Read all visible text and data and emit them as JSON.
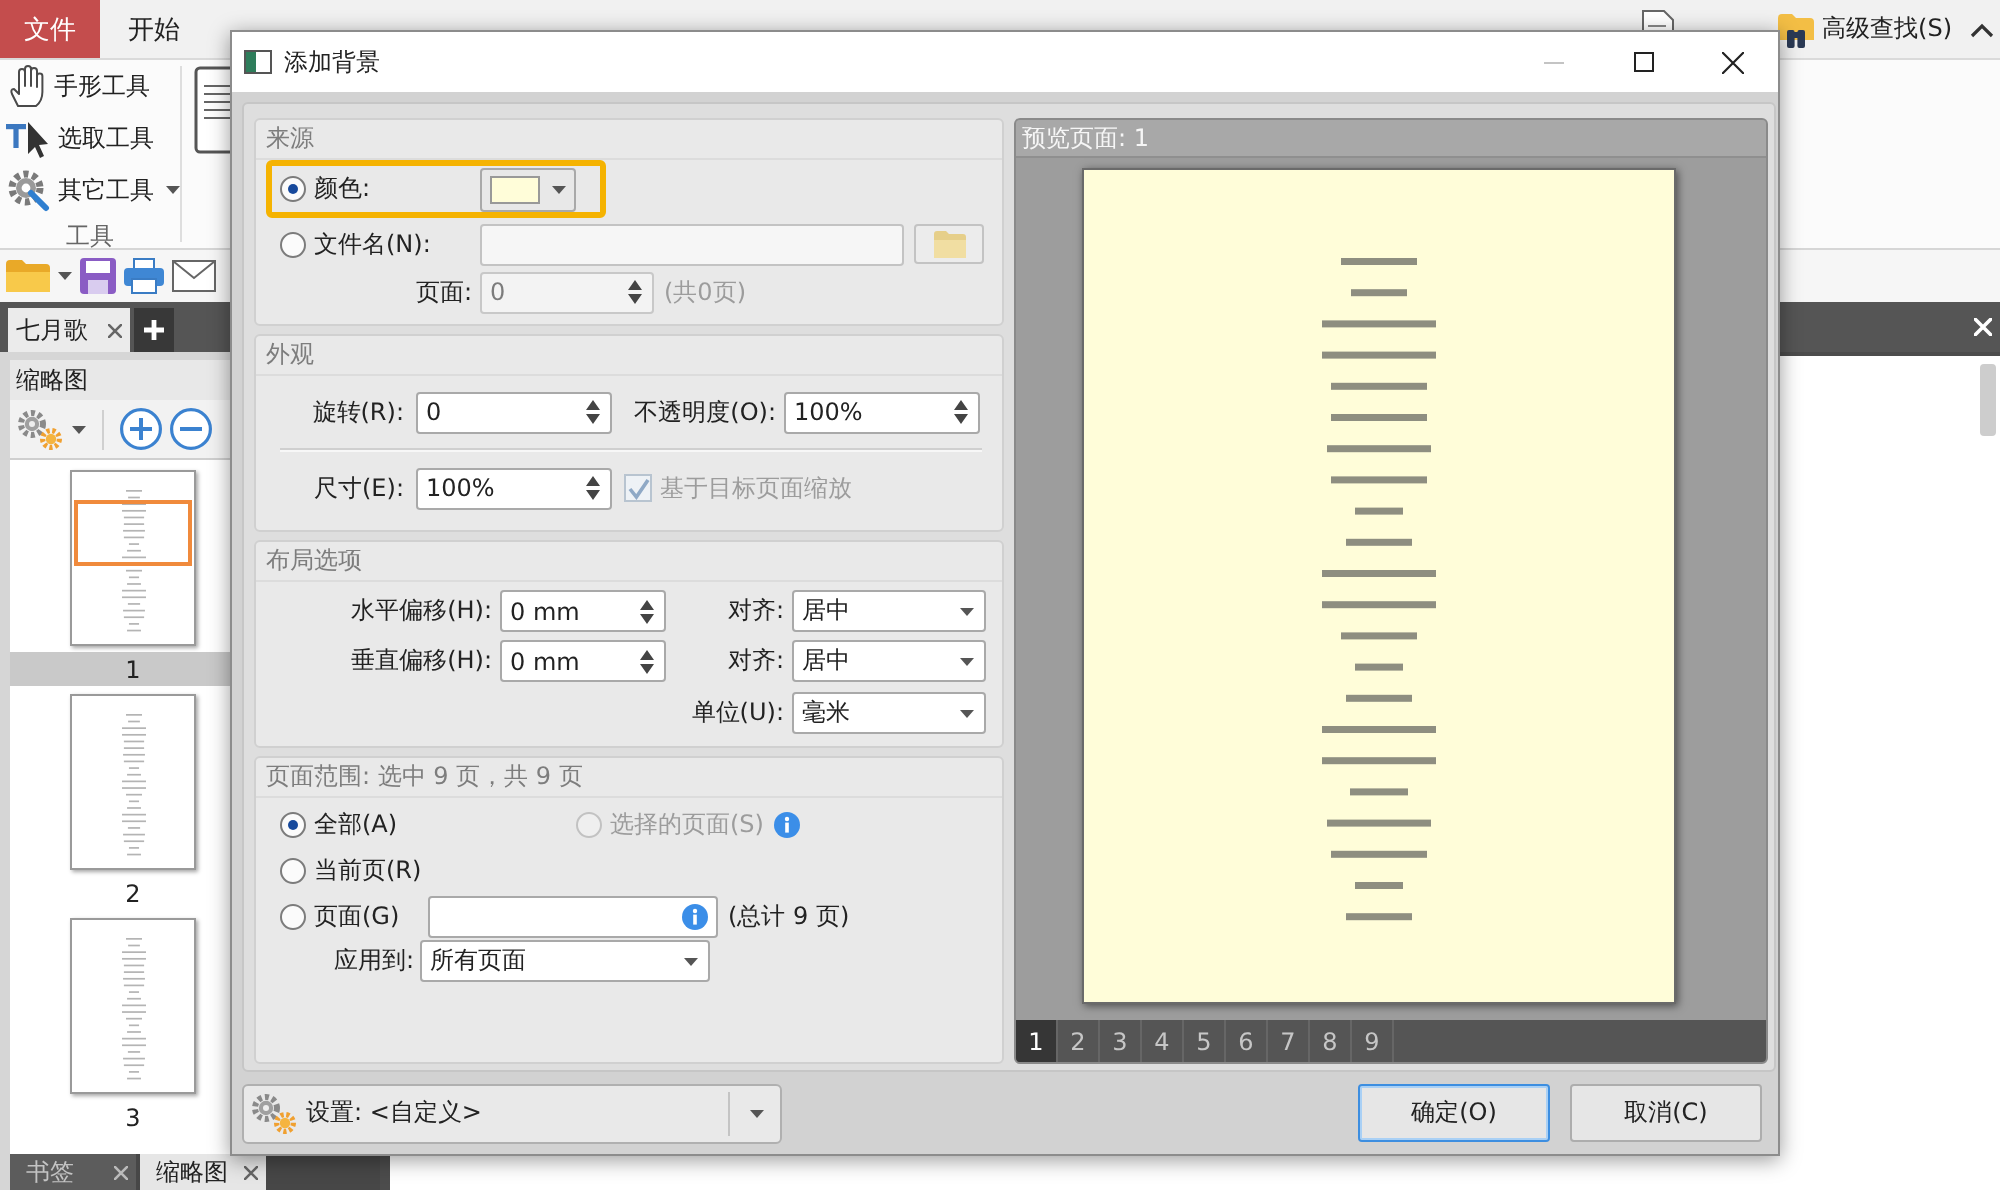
{
  "ribbon": {
    "tabs": [
      {
        "label": "文件",
        "kind": "file",
        "selected": false
      },
      {
        "label": "开始",
        "kind": "tab",
        "selected": false
      }
    ],
    "tools": [
      {
        "label": "手形工具",
        "dropdown": false
      },
      {
        "label": "选取工具",
        "dropdown": false
      },
      {
        "label": "其它工具",
        "dropdown": true
      }
    ],
    "tools_group_label": "工具",
    "advanced_find": "高级查找(S)"
  },
  "document_tabs": [
    {
      "label": "七月歌",
      "selected": true
    }
  ],
  "thumbnail_panel": {
    "title": "缩略图",
    "pages": [
      {
        "label": "1",
        "selected": true
      },
      {
        "label": "2",
        "selected": false
      },
      {
        "label": "3",
        "selected": false
      }
    ],
    "bottom_tabs": [
      {
        "label": "书签",
        "selected": false
      },
      {
        "label": "缩略图",
        "selected": true
      }
    ]
  },
  "dialog": {
    "title": "添加背景",
    "source": {
      "heading": "来源",
      "options": [
        {
          "kind": "color",
          "label": "颜色:",
          "selected": true,
          "highlighted": true,
          "color": "#fffdd9"
        },
        {
          "kind": "file",
          "label": "文件名(N):",
          "selected": false,
          "highlighted": false
        }
      ],
      "page": {
        "label": "页面:",
        "value": "0",
        "disabled": true,
        "total": "(共0页)"
      }
    },
    "appearance": {
      "heading": "外观",
      "fields": [
        {
          "label": "旋转(R):",
          "value": "0"
        },
        {
          "label": "不透明度(O):",
          "value": "100%"
        },
        {
          "label": "尺寸(E):",
          "value": "100%"
        }
      ],
      "scale_option": {
        "label": "基于目标页面缩放",
        "checked": true,
        "disabled": true
      }
    },
    "layout": {
      "heading": "布局选项",
      "rows": [
        {
          "label": "水平偏移(H):",
          "value": "0 mm",
          "align_label": "对齐:",
          "align_value": "居中"
        },
        {
          "label": "垂直偏移(H):",
          "value": "0 mm",
          "align_label": "对齐:",
          "align_value": "居中"
        }
      ],
      "unit": {
        "label": "单位(U):",
        "value": "毫米"
      }
    },
    "page_range": {
      "heading": "页面范围: 选中 9 页，共 9 页",
      "options": [
        {
          "kind": "all",
          "label": "全部(A)",
          "selected": true,
          "disabled": false
        },
        {
          "kind": "selection",
          "label": "选择的页面(S)",
          "selected": false,
          "disabled": true
        },
        {
          "kind": "current",
          "label": "当前页(R)",
          "selected": false,
          "disabled": false
        },
        {
          "kind": "pages",
          "label": "页面(G)",
          "selected": false,
          "disabled": false
        }
      ],
      "pages_total": "(总计 9 页)",
      "apply_to": {
        "label": "应用到:",
        "value": "所有页面"
      }
    },
    "preview": {
      "title": "预览页面: 1",
      "pages": [
        {
          "label": "1",
          "selected": true
        },
        {
          "label": "2",
          "selected": false
        },
        {
          "label": "3",
          "selected": false
        },
        {
          "label": "4",
          "selected": false
        },
        {
          "label": "5",
          "selected": false
        },
        {
          "label": "6",
          "selected": false
        },
        {
          "label": "7",
          "selected": false
        },
        {
          "label": "8",
          "selected": false
        },
        {
          "label": "9",
          "selected": false
        }
      ]
    },
    "settings": {
      "value": "设置: <自定义>"
    },
    "buttons": [
      {
        "label": "确定(O)",
        "focused": true
      },
      {
        "label": "取消(C)",
        "focused": false
      }
    ]
  }
}
